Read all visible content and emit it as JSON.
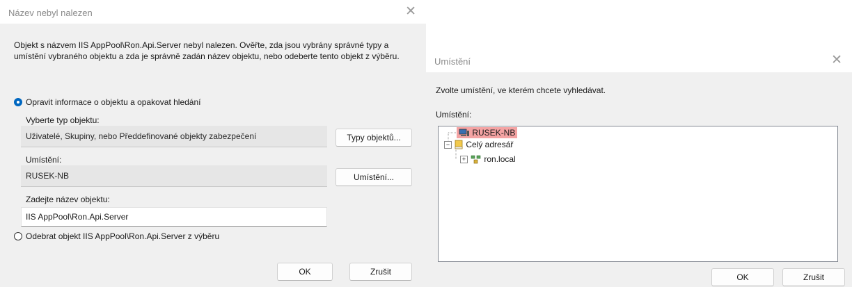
{
  "dialog1": {
    "title": "Název nebyl nalezen",
    "message": "Objekt s názvem IIS AppPool\\Ron.Api.Server nebyl nalezen. Ověřte, zda jsou vybrány správné typy a umístění vybraného objektu a zda je správně zadán název objektu, nebo odeberte tento objekt z výběru.",
    "option_fix": "Opravit informace o objektu a opakovat hledání",
    "object_type_label": "Vyberte typ objektu:",
    "object_type_value": "Uživatelé, Skupiny, nebo Předdefinované objekty zabezpečení",
    "object_types_button": "Typy objektů...",
    "location_label": "Umístění:",
    "location_value": "RUSEK-NB",
    "location_button": "Umístění...",
    "name_label": "Zadejte název objektu:",
    "name_value": "IIS AppPool\\Ron.Api.Server",
    "option_remove": "Odebrat objekt IIS AppPool\\Ron.Api.Server z výběru",
    "ok": "OK",
    "cancel": "Zrušit"
  },
  "dialog2": {
    "title": "Umístění",
    "instruction": "Zvolte umístění, ve kterém chcete vyhledávat.",
    "tree_label": "Umístění:",
    "tree": {
      "computer": "RUSEK-NB",
      "directory": "Celý adresář",
      "domain": "ron.local"
    },
    "ok": "OK",
    "cancel": "Zrušit"
  },
  "icons": {
    "close": "close-icon",
    "computer": "computer-icon",
    "directory": "book-icon",
    "domain": "domain-icon"
  },
  "colors": {
    "accent": "#0067c0",
    "selection": "#f4a3a3"
  }
}
